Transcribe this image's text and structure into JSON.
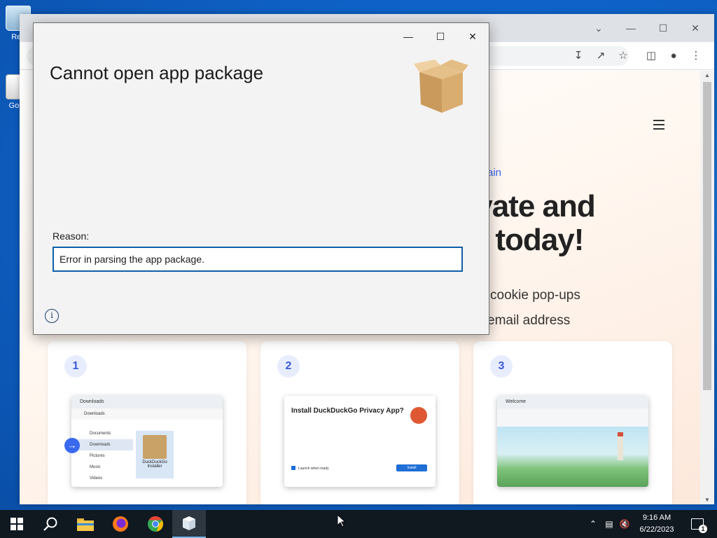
{
  "desktop": {
    "icons": [
      {
        "label": "Rec"
      },
      {
        "label": "Go In"
      }
    ]
  },
  "browser": {
    "content": {
      "link_fragment": "ain",
      "hero_line1": "ivate and",
      "hero_line2": "r today!",
      "sub_line1": "cookie pop-ups",
      "sub_line2": "email address",
      "cards": [
        {
          "number": "1",
          "tab_label": "Downloads",
          "path": "Downloads",
          "sidebar": [
            "Documents",
            "Downloads",
            "Pictures",
            "Music",
            "Videos"
          ],
          "file_label": "DuckDuckGo Installer"
        },
        {
          "number": "2",
          "title": "Install DuckDuckGo Privacy App?",
          "btn": "Install",
          "checkbox": "Launch when ready"
        },
        {
          "number": "3",
          "tab_label": "Welcome"
        }
      ]
    }
  },
  "dialog": {
    "title": "Cannot open app package",
    "reason_label": "Reason:",
    "reason_value": "Error in parsing the app package.",
    "info_glyph": "i"
  },
  "taskbar": {
    "clock_time": "9:16 AM",
    "clock_date": "6/22/2023",
    "notification_count": "1"
  },
  "colors": {
    "accent": "#0f5fa8",
    "ddg_blue": "#3969ef",
    "taskbar": "#101820"
  }
}
